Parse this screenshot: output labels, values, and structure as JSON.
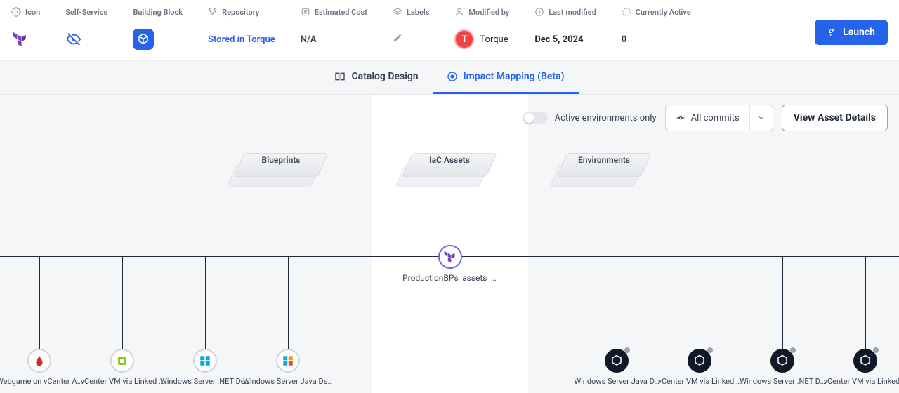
{
  "header": {
    "cols": {
      "icon": "Icon",
      "self_service": "Self-Service",
      "building_block": "Building Block",
      "repository": "Repository",
      "estimated_cost": "Estimated Cost",
      "labels": "Labels",
      "modified_by": "Modified by",
      "last_modified": "Last modified",
      "currently_active": "Currently Active"
    },
    "values": {
      "repository": "Stored in Torque",
      "estimated_cost": "N/A",
      "modified_by_name": "Torque",
      "modified_by_initial": "T",
      "last_modified": "Dec 5, 2024",
      "currently_active": "0"
    },
    "launch_label": "Launch"
  },
  "tabs": {
    "catalog": "Catalog Design",
    "impact": "Impact Mapping (Beta)"
  },
  "controls": {
    "toggle_label": "Active environments only",
    "commits_label": "All commits",
    "view_asset": "View Asset Details"
  },
  "categories": {
    "blueprints": "Blueprints",
    "iac": "IaC Assets",
    "environments": "Environments"
  },
  "center_node": "ProductionBPs_assets_…",
  "left_nodes": [
    "Webgame on vCenter A…",
    "vCenter VM via Linked …",
    "Windows Server .NET De…",
    "Windows Server Java De…"
  ],
  "right_nodes": [
    "Windows Server Java D…",
    "vCenter VM via Linked …",
    "Windows Server .NET D…",
    "vCenter VM via Linked …"
  ]
}
